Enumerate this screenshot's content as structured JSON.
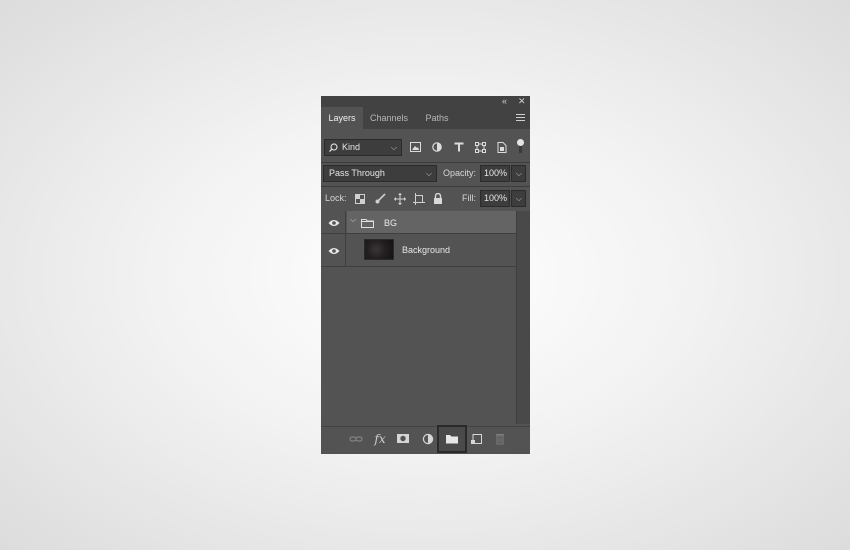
{
  "panel": {
    "collapse_glyph": "«",
    "close_glyph": "✕",
    "tabs": [
      {
        "label": "Layers",
        "active": true
      },
      {
        "label": "Channels",
        "active": false
      },
      {
        "label": "Paths",
        "active": false
      }
    ],
    "filter": {
      "kind_label": "Kind",
      "filter_icons": [
        "image-filter-icon",
        "adjustment-filter-icon",
        "type-filter-icon",
        "shape-filter-icon",
        "smart-object-filter-icon"
      ]
    },
    "blend": {
      "mode": "Pass Through",
      "opacity_label": "Opacity:",
      "opacity_value": "100%"
    },
    "lock": {
      "label": "Lock:",
      "icons": [
        "lock-transparent-icon",
        "lock-image-icon",
        "lock-position-icon",
        "lock-artboard-icon",
        "lock-all-icon"
      ],
      "fill_label": "Fill:",
      "fill_value": "100%"
    },
    "layers": [
      {
        "name": "BG",
        "type": "group",
        "visible": true,
        "expanded": true
      },
      {
        "name": "Background",
        "type": "image",
        "visible": true
      }
    ],
    "bottom_icons": [
      "link-layers-icon",
      "fx-icon",
      "add-mask-icon",
      "adjustment-layer-icon",
      "new-group-icon",
      "new-layer-icon",
      "delete-icon"
    ],
    "fx_text": "fx",
    "colors": {
      "panel_bg": "#535353",
      "tab_bar_bg": "#424242",
      "field_bg": "#3d3d3d",
      "selected_row_bg": "#646464",
      "page_bg": "#e8e8e8"
    }
  }
}
